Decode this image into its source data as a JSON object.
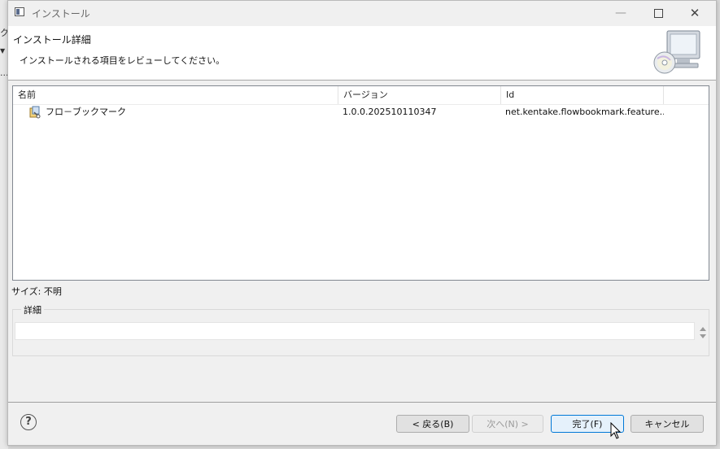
{
  "background": {
    "fragments": [
      "ク",
      "▼",
      "..."
    ]
  },
  "window": {
    "title": "インストール",
    "icons": {
      "app": "window-app-icon",
      "minimize": "minimize-icon",
      "maximize": "maximize-icon",
      "close": "close-icon"
    },
    "minimize_glyph": "—",
    "close_glyph": "✕"
  },
  "header": {
    "title": "インストール詳細",
    "description": "インストールされる項目をレビューしてください。",
    "graphic": "computer-cd-icon"
  },
  "table": {
    "columns": [
      "名前",
      "バージョン",
      "Id"
    ],
    "rows": [
      {
        "name": "フロ－ブックマーク",
        "version": "1.0.0.202510110347",
        "id": "net.kentake.flowbookmark.feature....",
        "icon": "feature-icon"
      }
    ]
  },
  "size_label": "サイズ: 不明",
  "details": {
    "label": "詳細",
    "value": ""
  },
  "footer": {
    "help_glyph": "?",
    "back_label": "< 戻る(B)",
    "next_label": "次へ(N) >",
    "finish_label": "完了(F)",
    "cancel_label": "キャンセル"
  },
  "colors": {
    "accent": "#0078d7",
    "window_bg": "#f0f0f0",
    "header_bg": "#ffffff"
  }
}
